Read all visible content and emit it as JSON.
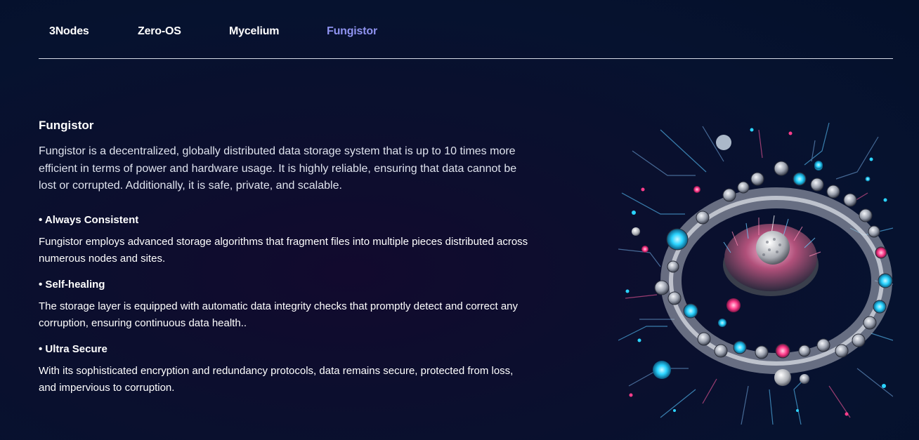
{
  "tabs": [
    {
      "label": "3Nodes",
      "active": false
    },
    {
      "label": "Zero-OS",
      "active": false
    },
    {
      "label": "Mycelium",
      "active": false
    },
    {
      "label": "Fungistor",
      "active": true
    }
  ],
  "colors": {
    "background": "#06122f",
    "active_tab": "#8f93f0",
    "divider": "#d6dae6",
    "accent_cyan": "#2ad4ff",
    "accent_pink": "#ff3d8b"
  },
  "main": {
    "title": "Fungistor",
    "intro": "Fungistor is a decentralized, globally distributed data storage system that is up to 10 times more efficient in terms of power and hardware usage. It is highly reliable, ensuring that data cannot be lost or corrupted. Additionally, it is safe, private, and scalable.",
    "features": [
      {
        "title": "• Always Consistent",
        "text": "Fungistor employs advanced storage algorithms that fragment files into multiple pieces distributed across numerous nodes and sites."
      },
      {
        "title": "• Self-healing",
        "text": "The storage layer is equipped with automatic data integrity checks that promptly detect and correct any corruption, ensuring continuous data health.."
      },
      {
        "title": "• Ultra Secure",
        "text": "With its sophisticated encryption and redundancy protocols, data remains secure, protected from loss, and impervious to corruption."
      }
    ]
  }
}
